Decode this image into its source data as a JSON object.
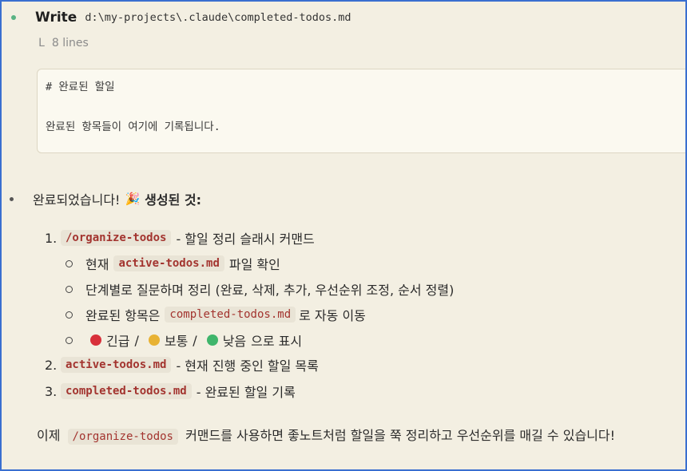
{
  "write": {
    "label": "Write",
    "path": "d:\\my-projects\\.claude\\completed-todos.md",
    "branch": "L",
    "lines": "8 lines"
  },
  "preview": {
    "line1": "# 완료된 할일",
    "line3": "완료된 항목들이 여기에 기록됩니다."
  },
  "summary": {
    "text": "완료되었습니다!",
    "emoji": "🎉",
    "bold": "생성된 것:"
  },
  "list": [
    {
      "num": "1.",
      "code": "/organize-todos",
      "text": "- 할일 정리 슬래시 커맨드"
    },
    {
      "num": "2.",
      "code": "active-todos.md",
      "text": "- 현재 진행 중인 할일 목록"
    },
    {
      "num": "3.",
      "code": "completed-todos.md",
      "text": "- 완료된 할일 기록"
    }
  ],
  "sublist": {
    "item1_pre": "현재",
    "item1_code": "active-todos.md",
    "item1_post": "파일 확인",
    "item2": "단계별로 질문하며 정리 (완료, 삭제, 추가, 우선순위 조정, 순서 정렬)",
    "item3_pre": "완료된 항목은",
    "item3_code": "completed-todos.md",
    "item3_post": "로 자동 이동",
    "item4_urgent": "긴급",
    "item4_normal": "보통",
    "item4_low": "낮음",
    "item4_post": "으로 표시",
    "slash": "/"
  },
  "final": {
    "pre": "이제",
    "code": "/organize-todos",
    "post": "커맨드를 사용하면 좋노트처럼 할일을 쭉 정리하고 우선순위를 매길 수 있습니다!"
  },
  "colors": {
    "red": "#d8303a",
    "yellow": "#e8b233",
    "green": "#3fb56b"
  }
}
